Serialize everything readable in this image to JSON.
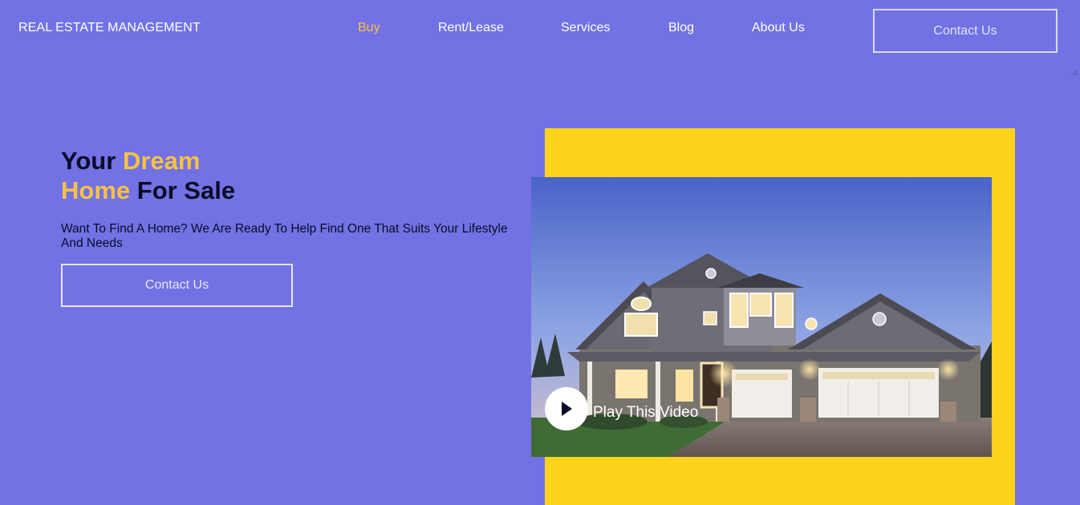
{
  "header": {
    "brand": "REAL ESTATE MANAGEMENT",
    "nav": [
      {
        "label": "Buy",
        "active": true
      },
      {
        "label": "Rent/Lease",
        "active": false
      },
      {
        "label": "Services",
        "active": false
      },
      {
        "label": "Blog",
        "active": false
      },
      {
        "label": "About Us",
        "active": false
      }
    ],
    "contact_label": "Contact Us"
  },
  "hero": {
    "title_part1": "Your ",
    "title_highlight1": "Dream",
    "title_highlight2": "Home",
    "title_part2": " For Sale",
    "subtitle": "Want To Find A Home? We Are Ready To Help Find One That Suits Your Lifestyle And Needs",
    "contact_label": "Contact Us"
  },
  "media": {
    "play_label": "Play This Video",
    "play_icon": "play-icon",
    "image_subject": "house-photo"
  },
  "colors": {
    "background": "#7272e4",
    "accent": "#f6c244",
    "frame": "#fdd31b",
    "text_dark": "#0b0b28"
  }
}
